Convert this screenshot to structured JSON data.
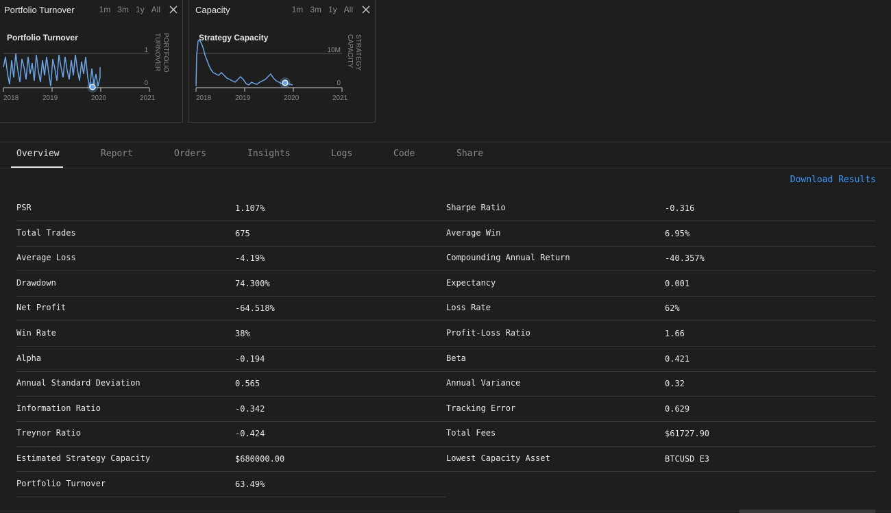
{
  "cards": [
    {
      "header_title": "Portfolio Turnover",
      "ranges": [
        "1m",
        "3m",
        "1y",
        "All"
      ],
      "chart_title": "Portfolio Turnover",
      "axis_label_line1": "PORTFOLIO",
      "axis_label_line2": "TURNOVER",
      "y_ticks": [
        "1",
        "0"
      ],
      "x_ticks": [
        "2018",
        "2019",
        "2020",
        "2021"
      ]
    },
    {
      "header_title": "Capacity",
      "ranges": [
        "1m",
        "3m",
        "1y",
        "All"
      ],
      "chart_title": "Strategy Capacity",
      "axis_label_line1": "STRATEGY",
      "axis_label_line2": "CAPACITY",
      "y_ticks": [
        "10M",
        "0"
      ],
      "x_ticks": [
        "2018",
        "2019",
        "2020",
        "2021"
      ]
    }
  ],
  "tabs": [
    "Overview",
    "Report",
    "Orders",
    "Insights",
    "Logs",
    "Code",
    "Share"
  ],
  "download_label": "Download Results",
  "stats_left": [
    {
      "label": "PSR",
      "value": "1.107%"
    },
    {
      "label": "Total Trades",
      "value": "675"
    },
    {
      "label": "Average Loss",
      "value": "-4.19%"
    },
    {
      "label": "Drawdown",
      "value": "74.300%"
    },
    {
      "label": "Net Profit",
      "value": "-64.518%"
    },
    {
      "label": "Win Rate",
      "value": "38%"
    },
    {
      "label": "Alpha",
      "value": "-0.194"
    },
    {
      "label": "Annual Standard Deviation",
      "value": "0.565"
    },
    {
      "label": "Information Ratio",
      "value": "-0.342"
    },
    {
      "label": "Treynor Ratio",
      "value": "-0.424"
    },
    {
      "label": "Estimated Strategy Capacity",
      "value": "$680000.00"
    },
    {
      "label": "Portfolio Turnover",
      "value": "63.49%"
    }
  ],
  "stats_right": [
    {
      "label": "Sharpe Ratio",
      "value": "-0.316"
    },
    {
      "label": "Average Win",
      "value": "6.95%"
    },
    {
      "label": "Compounding Annual Return",
      "value": "-40.357%"
    },
    {
      "label": "Expectancy",
      "value": "0.001"
    },
    {
      "label": "Loss Rate",
      "value": "62%"
    },
    {
      "label": "Profit-Loss Ratio",
      "value": "1.66"
    },
    {
      "label": "Beta",
      "value": "0.421"
    },
    {
      "label": "Annual Variance",
      "value": "0.32"
    },
    {
      "label": "Tracking Error",
      "value": "0.629"
    },
    {
      "label": "Total Fees",
      "value": "$61727.90"
    },
    {
      "label": "Lowest Capacity Asset",
      "value": "BTCUSD E3"
    }
  ],
  "colors": {
    "line": "#6aa6e8",
    "accent": "#3d9bff",
    "background": "#1e1e1e"
  },
  "icons": {
    "close": "close-icon"
  }
}
